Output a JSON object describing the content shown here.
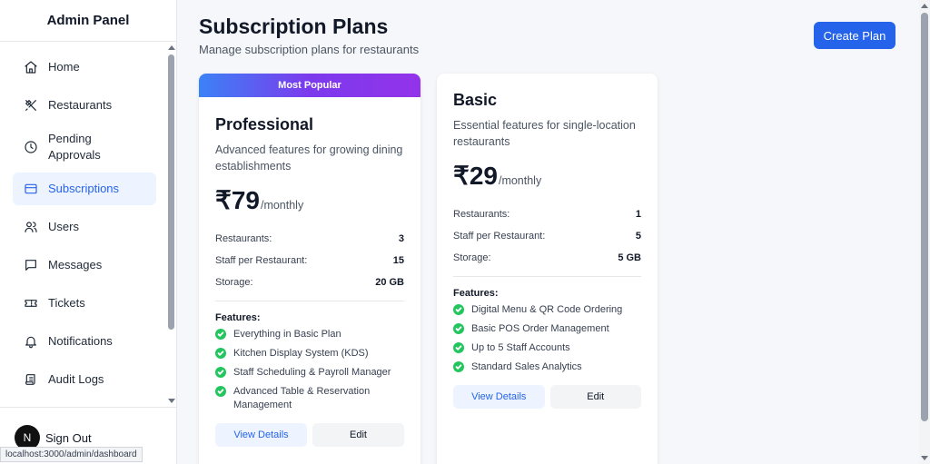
{
  "sidebar": {
    "title": "Admin Panel",
    "items": [
      {
        "label": "Home",
        "icon": "home-icon"
      },
      {
        "label": "Restaurants",
        "icon": "utensils-icon"
      },
      {
        "label": "Pending Approvals",
        "icon": "clock-icon"
      },
      {
        "label": "Subscriptions",
        "icon": "credit-card-icon",
        "active": true
      },
      {
        "label": "Users",
        "icon": "users-icon"
      },
      {
        "label": "Messages",
        "icon": "message-icon"
      },
      {
        "label": "Tickets",
        "icon": "ticket-icon"
      },
      {
        "label": "Notifications",
        "icon": "bell-icon"
      },
      {
        "label": "Audit Logs",
        "icon": "scroll-icon"
      }
    ],
    "signout_label": "Sign Out",
    "avatar_letter": "N"
  },
  "status_url": "localhost:3000/admin/dashboard",
  "header": {
    "title": "Subscription Plans",
    "subtitle": "Manage subscription plans for restaurants",
    "create_label": "Create Plan"
  },
  "plans": [
    {
      "badge": "Most Popular",
      "name": "Professional",
      "description": "Advanced features for growing dining establishments",
      "price": "₹79",
      "period": "/monthly",
      "specs": [
        {
          "label": "Restaurants:",
          "value": "3"
        },
        {
          "label": "Staff per Restaurant:",
          "value": "15"
        },
        {
          "label": "Storage:",
          "value": "20 GB"
        }
      ],
      "features_title": "Features:",
      "features": [
        "Everything in Basic Plan",
        "Kitchen Display System (KDS)",
        "Staff Scheduling & Payroll Manager",
        "Advanced Table & Reservation Management"
      ],
      "view_label": "View Details",
      "edit_label": "Edit"
    },
    {
      "name": "Basic",
      "description": "Essential features for single-location restaurants",
      "price": "₹29",
      "period": "/monthly",
      "specs": [
        {
          "label": "Restaurants:",
          "value": "1"
        },
        {
          "label": "Staff per Restaurant:",
          "value": "5"
        },
        {
          "label": "Storage:",
          "value": "5 GB"
        }
      ],
      "features_title": "Features:",
      "features": [
        "Digital Menu & QR Code Ordering",
        "Basic POS Order Management",
        "Up to 5 Staff Accounts",
        "Standard Sales Analytics"
      ],
      "view_label": "View Details",
      "edit_label": "Edit"
    }
  ],
  "colors": {
    "accent": "#2563eb",
    "check": "#22c55e",
    "active_bg": "#eef4ff"
  }
}
